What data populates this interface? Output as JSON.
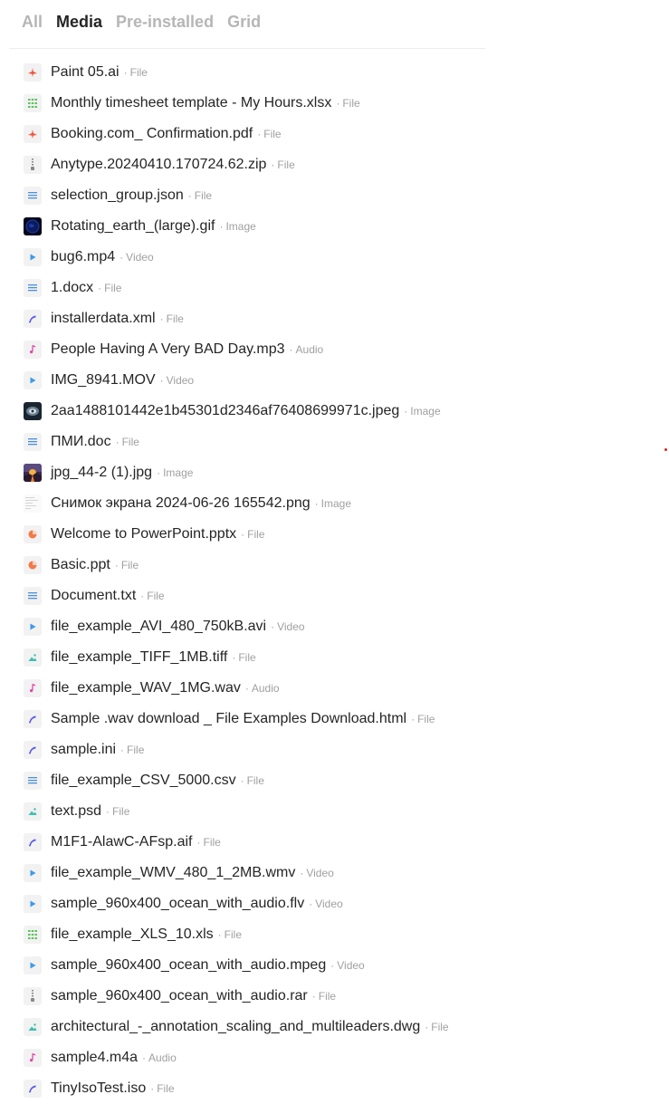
{
  "tabs": [
    {
      "label": "All",
      "active": false
    },
    {
      "label": "Media",
      "active": true
    },
    {
      "label": "Pre-installed",
      "active": false
    },
    {
      "label": "Grid",
      "active": false
    }
  ],
  "separator": "·",
  "items": [
    {
      "name": "Paint 05.ai",
      "type": "File",
      "icon": "pdf-icon"
    },
    {
      "name": "Monthly timesheet template - My Hours.xlsx",
      "type": "File",
      "icon": "spreadsheet-icon"
    },
    {
      "name": "Booking.com_ Confirmation.pdf",
      "type": "File",
      "icon": "pdf-icon"
    },
    {
      "name": "Anytype.20240410.170724.62.zip",
      "type": "File",
      "icon": "archive-icon"
    },
    {
      "name": "selection_group.json",
      "type": "File",
      "icon": "text-doc-icon"
    },
    {
      "name": "Rotating_earth_(large).gif",
      "type": "Image",
      "icon": "earth-thumbnail-icon"
    },
    {
      "name": "bug6.mp4",
      "type": "Video",
      "icon": "video-icon"
    },
    {
      "name": "1.docx",
      "type": "File",
      "icon": "text-doc-icon"
    },
    {
      "name": "installerdata.xml",
      "type": "File",
      "icon": "code-icon"
    },
    {
      "name": "People Having A Very BAD Day.mp3",
      "type": "Audio",
      "icon": "audio-icon"
    },
    {
      "name": "IMG_8941.MOV",
      "type": "Video",
      "icon": "video-icon"
    },
    {
      "name": "2aa1488101442e1b45301d2346af76408699971c.jpeg",
      "type": "Image",
      "icon": "photo-thumbnail-icon"
    },
    {
      "name": "ПМИ.doc",
      "type": "File",
      "icon": "text-doc-icon"
    },
    {
      "name": "jpg_44-2 (1).jpg",
      "type": "Image",
      "icon": "sunset-thumbnail-icon"
    },
    {
      "name": "Снимок экрана 2024-06-26 165542.png",
      "type": "Image",
      "icon": "screenshot-thumbnail-icon"
    },
    {
      "name": "Welcome to PowerPoint.pptx",
      "type": "File",
      "icon": "presentation-icon"
    },
    {
      "name": "Basic.ppt",
      "type": "File",
      "icon": "presentation-icon"
    },
    {
      "name": "Document.txt",
      "type": "File",
      "icon": "text-doc-icon"
    },
    {
      "name": "file_example_AVI_480_750kB.avi",
      "type": "Video",
      "icon": "video-icon"
    },
    {
      "name": "file_example_TIFF_1MB.tiff",
      "type": "File",
      "icon": "image-file-icon"
    },
    {
      "name": "file_example_WAV_1MG.wav",
      "type": "Audio",
      "icon": "audio-icon"
    },
    {
      "name": "Sample .wav download _ File Examples Download.html",
      "type": "File",
      "icon": "code-icon"
    },
    {
      "name": "sample.ini",
      "type": "File",
      "icon": "code-icon"
    },
    {
      "name": "file_example_CSV_5000.csv",
      "type": "File",
      "icon": "text-doc-icon"
    },
    {
      "name": "text.psd",
      "type": "File",
      "icon": "image-file-icon"
    },
    {
      "name": "M1F1-AlawC-AFsp.aif",
      "type": "File",
      "icon": "code-icon"
    },
    {
      "name": "file_example_WMV_480_1_2MB.wmv",
      "type": "Video",
      "icon": "video-icon"
    },
    {
      "name": "sample_960x400_ocean_with_audio.flv",
      "type": "Video",
      "icon": "video-icon"
    },
    {
      "name": "file_example_XLS_10.xls",
      "type": "File",
      "icon": "spreadsheet-icon"
    },
    {
      "name": "sample_960x400_ocean_with_audio.mpeg",
      "type": "Video",
      "icon": "video-icon"
    },
    {
      "name": "sample_960x400_ocean_with_audio.rar",
      "type": "File",
      "icon": "archive-icon"
    },
    {
      "name": "architectural_-_annotation_scaling_and_multileaders.dwg",
      "type": "File",
      "icon": "image-file-icon"
    },
    {
      "name": "sample4.m4a",
      "type": "Audio",
      "icon": "audio-icon"
    },
    {
      "name": "TinyIsoTest.iso",
      "type": "File",
      "icon": "code-icon"
    }
  ],
  "colors": {
    "text": "#252525",
    "muted": "#a0a0a0",
    "tab_inactive": "#b6b6b6",
    "pdf": "#e8553e",
    "spreadsheet": "#5cc35c",
    "text_doc": "#4a8fe0",
    "video": "#3d9ae8",
    "code": "#5b5be8",
    "audio": "#e04aa8",
    "presentation": "#f07a4a",
    "image_file": "#3fbfb0"
  }
}
